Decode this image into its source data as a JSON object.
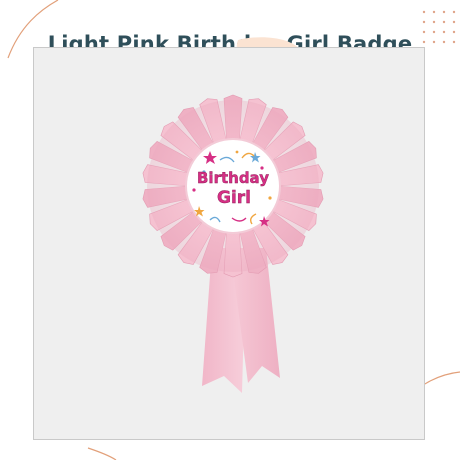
{
  "page": {
    "title": "Light Pink Birthday Girl Badge"
  },
  "product": {
    "badge_line1": "Birthday",
    "badge_line2": "Girl",
    "ribbon_color": "#f4bfcf",
    "text_color": "#d62f85"
  },
  "decor": {
    "accent_color": "#e2a07a",
    "dot_color": "#e0a58a"
  }
}
